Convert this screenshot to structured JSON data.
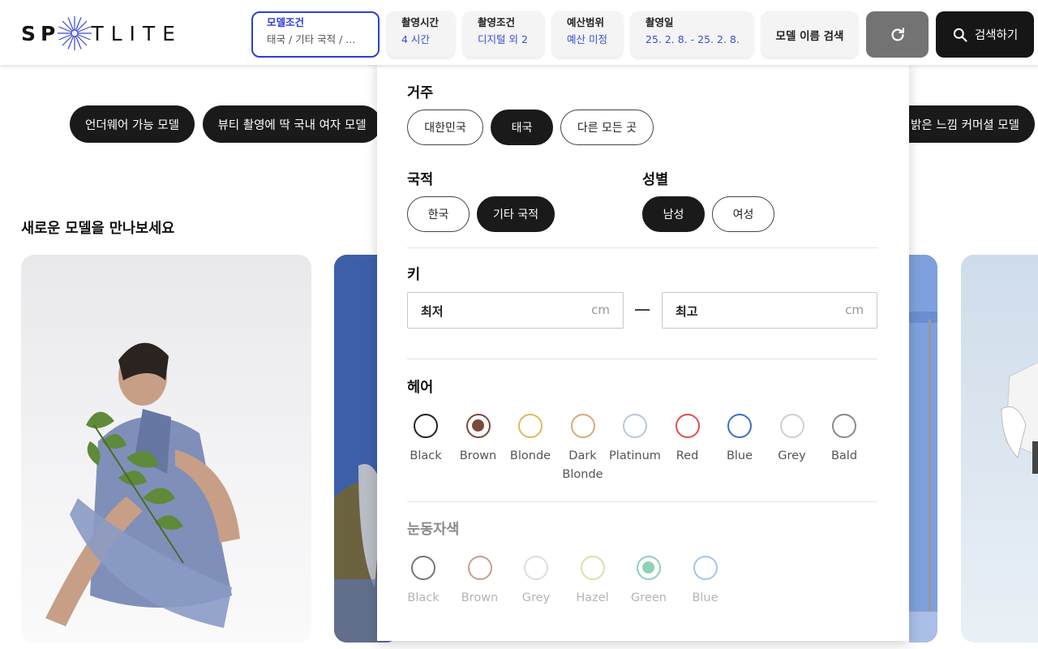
{
  "brand": {
    "logo_left": "SP",
    "logo_right": "TLITE"
  },
  "filters": [
    {
      "title": "모델조건",
      "value": "태국 / 기타 국적 / ..."
    },
    {
      "title": "촬영시간",
      "value": "4 시간"
    },
    {
      "title": "촬영조건",
      "value": "디지털 외 2"
    },
    {
      "title": "예산범위",
      "value": "예산 미정"
    },
    {
      "title": "촬영일",
      "value": "25. 2. 8. - 25. 2. 8."
    }
  ],
  "name_search_label": "모델 이름 검색",
  "search_label": "검색하기",
  "chips": [
    "언더웨어 가능 모델",
    "뷰티 촬영에 딱 국내 여자 모델",
    "밝은 느낌 커머셜 모델"
  ],
  "section_title": "새로운 모델을 만나보세요",
  "panel": {
    "residence": {
      "label": "거주",
      "options": [
        "대한민국",
        "태국",
        "다른 모든 곳"
      ],
      "selected": "태국"
    },
    "nationality": {
      "label": "국적",
      "options": [
        "한국",
        "기타 국적"
      ],
      "selected": "기타 국적"
    },
    "gender": {
      "label": "성별",
      "options": [
        "남성",
        "여성"
      ],
      "selected": "남성"
    },
    "height": {
      "label": "키",
      "min_placeholder": "최저",
      "max_placeholder": "최고",
      "unit": "cm"
    },
    "hair": {
      "label": "헤어",
      "options": [
        {
          "name": "Black",
          "color": "#222222"
        },
        {
          "name": "Brown",
          "color": "#7a4a3a",
          "selected": true
        },
        {
          "name": "Blonde",
          "color": "#e2b85a"
        },
        {
          "name": "Dark Blonde",
          "color": "#d9a878"
        },
        {
          "name": "Platinum",
          "color": "#b9c8da"
        },
        {
          "name": "Red",
          "color": "#e05048"
        },
        {
          "name": "Blue",
          "color": "#3a6fc4"
        },
        {
          "name": "Grey",
          "color": "#cfcfcf"
        },
        {
          "name": "Bald",
          "color": "#8a8a8a"
        }
      ]
    },
    "eye": {
      "label": "눈동자색",
      "options": [
        {
          "name": "Black",
          "color": "#777777"
        },
        {
          "name": "Brown",
          "color": "#c4a090"
        },
        {
          "name": "Grey",
          "color": "#dddddd"
        },
        {
          "name": "Hazel",
          "color": "#e0dcb0"
        },
        {
          "name": "Green",
          "color": "#8ed2b5",
          "selected": true
        },
        {
          "name": "Blue",
          "color": "#a4c4ea"
        }
      ]
    }
  }
}
